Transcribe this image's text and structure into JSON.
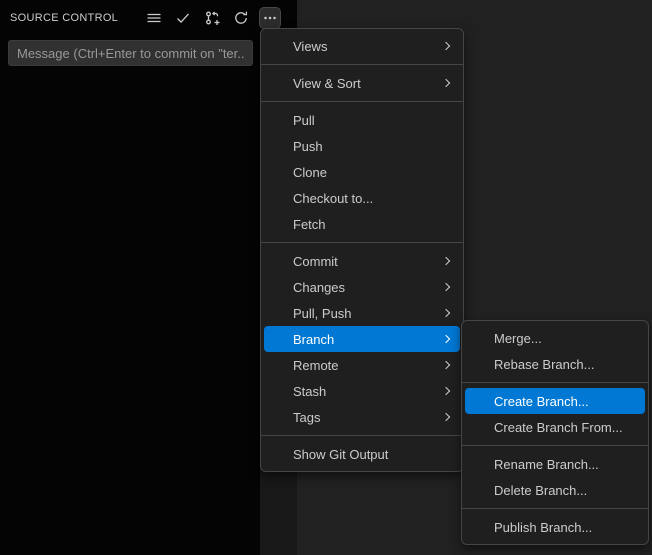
{
  "sidebar": {
    "title": "SOURCE CONTROL",
    "toolbar": {
      "icons": [
        "list-view",
        "commit-check",
        "git-branch-plus",
        "refresh",
        "more-actions"
      ]
    },
    "commit_input": {
      "placeholder": "Message (Ctrl+Enter to commit on \"ter..."
    }
  },
  "main_menu": {
    "items": [
      {
        "label": "Views",
        "has_submenu": true
      },
      {
        "label": "View & Sort",
        "has_submenu": true
      },
      {
        "label": "Pull",
        "has_submenu": false
      },
      {
        "label": "Push",
        "has_submenu": false
      },
      {
        "label": "Clone",
        "has_submenu": false
      },
      {
        "label": "Checkout to...",
        "has_submenu": false
      },
      {
        "label": "Fetch",
        "has_submenu": false
      },
      {
        "label": "Commit",
        "has_submenu": true
      },
      {
        "label": "Changes",
        "has_submenu": true
      },
      {
        "label": "Pull, Push",
        "has_submenu": true
      },
      {
        "label": "Branch",
        "has_submenu": true,
        "selected": true
      },
      {
        "label": "Remote",
        "has_submenu": true
      },
      {
        "label": "Stash",
        "has_submenu": true
      },
      {
        "label": "Tags",
        "has_submenu": true
      },
      {
        "label": "Show Git Output",
        "has_submenu": false
      }
    ]
  },
  "branch_submenu": {
    "items": [
      {
        "label": "Merge..."
      },
      {
        "label": "Rebase Branch..."
      },
      {
        "label": "Create Branch...",
        "selected": true
      },
      {
        "label": "Create Branch From..."
      },
      {
        "label": "Rename Branch..."
      },
      {
        "label": "Delete Branch..."
      },
      {
        "label": "Publish Branch..."
      }
    ]
  },
  "colors": {
    "selection_background": "#0078d4",
    "selection_text": "#ffffff",
    "menu_background": "#1f1f1f",
    "menu_border": "#454545",
    "menu_text": "#cccccc",
    "sidebar_background": "#040404",
    "editor_background": "#212121",
    "input_background": "#313131",
    "input_placeholder": "#989898"
  }
}
